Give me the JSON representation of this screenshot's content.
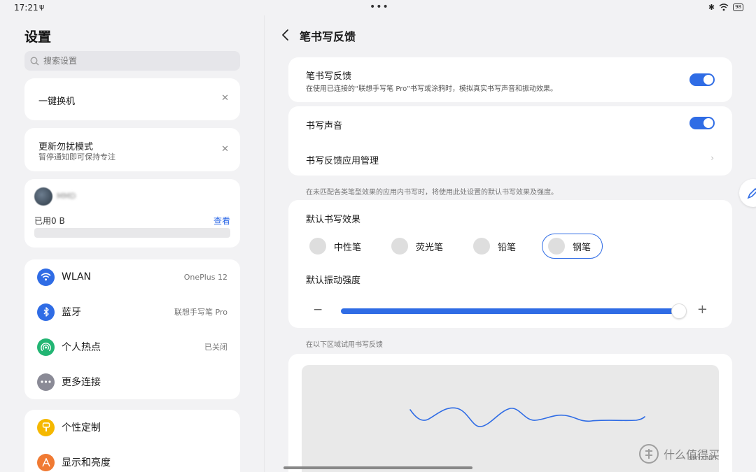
{
  "status_bar": {
    "time": "17:21",
    "battery": "98"
  },
  "left": {
    "title": "设置",
    "search_placeholder": "搜索设置",
    "suggestion_1": {
      "title": "一键换机"
    },
    "suggestion_2": {
      "title": "更新勿扰模式",
      "subtitle": "暂停通知即可保持专注"
    },
    "account": {
      "name": "MMD",
      "storage_used": "已用0 B",
      "link": "查看"
    },
    "connections": [
      {
        "label": "WLAN",
        "value": "OnePlus 12",
        "icon": "wifi-icon",
        "color": "#2f6ce5"
      },
      {
        "label": "蓝牙",
        "value": "联想手写笔 Pro",
        "icon": "bluetooth-icon",
        "color": "#2f6ce5"
      },
      {
        "label": "个人热点",
        "value": "已关闭",
        "icon": "hotspot-icon",
        "color": "#22b573"
      },
      {
        "label": "更多连接",
        "value": "",
        "icon": "more-icon",
        "color": "#8a8a96"
      }
    ],
    "personal": [
      {
        "label": "个性定制",
        "icon": "brush-icon",
        "color": "#f5b800"
      },
      {
        "label": "显示和亮度",
        "icon": "display-icon",
        "color": "#f07a33"
      }
    ]
  },
  "right": {
    "title": "笔书写反馈",
    "feedback": {
      "title": "笔书写反馈",
      "subtitle": "在使用已连接的“联想手写笔 Pro”书写或涂鸦时，模拟真实书写声音和振动效果。",
      "on": true
    },
    "sound": {
      "title": "书写声音",
      "on": true
    },
    "app_mgmt": {
      "title": "书写反馈应用管理"
    },
    "note_default": "在未匹配各类笔型效果的应用内书写时，将使用此处设置的默认书写效果及强度。",
    "effect_title": "默认书写效果",
    "pens": [
      {
        "label": "中性笔",
        "selected": false
      },
      {
        "label": "荧光笔",
        "selected": false
      },
      {
        "label": "铅笔",
        "selected": false
      },
      {
        "label": "钢笔",
        "selected": true
      }
    ],
    "vibration_title": "默认振动强度",
    "vibration_level": 1.0,
    "minus": "−",
    "plus": "+",
    "try_note": "在以下区域试用书写反馈"
  },
  "watermark": {
    "text": "什么值得买",
    "sub": "SMYZ.NET"
  },
  "colors": {
    "accent": "#2f6ce5",
    "background": "#f2f2f4",
    "card": "#ffffff"
  }
}
